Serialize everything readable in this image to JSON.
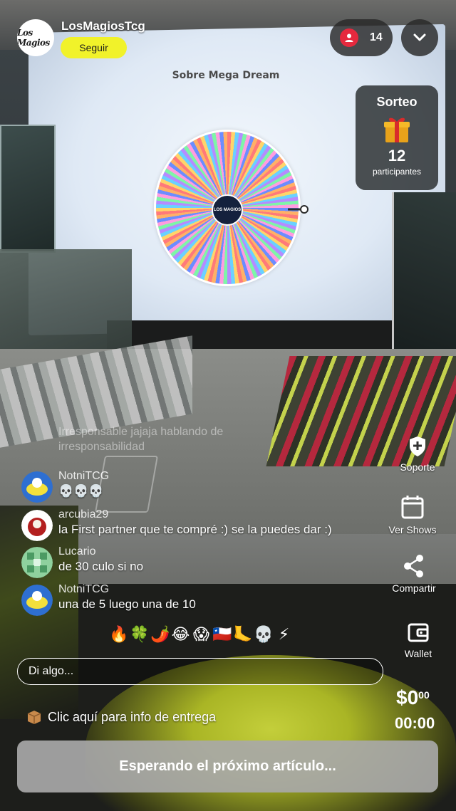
{
  "stream": {
    "username": "LosMagiosTcg",
    "avatar_logo_text": "Los Magios TCG",
    "follow_label": "Seguir",
    "viewer_count": "14",
    "screen_title": "Sobre Mega Dream"
  },
  "giveaway": {
    "title": "Sorteo",
    "icon": "gift-icon",
    "count": "12",
    "label": "participantes"
  },
  "side_actions": [
    {
      "label": "Soporte",
      "icon": "shield-plus-icon"
    },
    {
      "label": "Ver Shows",
      "icon": "calendar-icon"
    },
    {
      "label": "Compartir",
      "icon": "share-icon"
    },
    {
      "label": "Wallet",
      "icon": "wallet-icon"
    }
  ],
  "chat": {
    "faded_message": "Irresponsable jajaja hablando de irresponsabilidad",
    "messages": [
      {
        "user": "NotniTCG",
        "text": "💀💀💀"
      },
      {
        "user": "arcubia29",
        "text": "la First partner que te compré :) se la puedes dar :)"
      },
      {
        "user": "Lucario",
        "text": "de 30 culo si no"
      },
      {
        "user": "NotniTCG",
        "text": "una de 5 luego una de 10"
      }
    ]
  },
  "emojis": [
    "🔥",
    "🍀",
    "🌶️",
    "😂",
    "😱",
    "🇨🇱",
    "🦶",
    "💀",
    "⚡"
  ],
  "input": {
    "placeholder": "Di algo..."
  },
  "wallet": {
    "amount": "$0",
    "cents": "00",
    "timer": "00:00"
  },
  "delivery": {
    "icon": "package-icon",
    "text": "Clic aquí para info de entrega"
  },
  "bid_button": {
    "label": "Esperando el próximo artículo..."
  },
  "colors": {
    "follow": "#f1f22a",
    "viewer_badge": "#e5293e",
    "button_gray": "#a8a8a8"
  }
}
